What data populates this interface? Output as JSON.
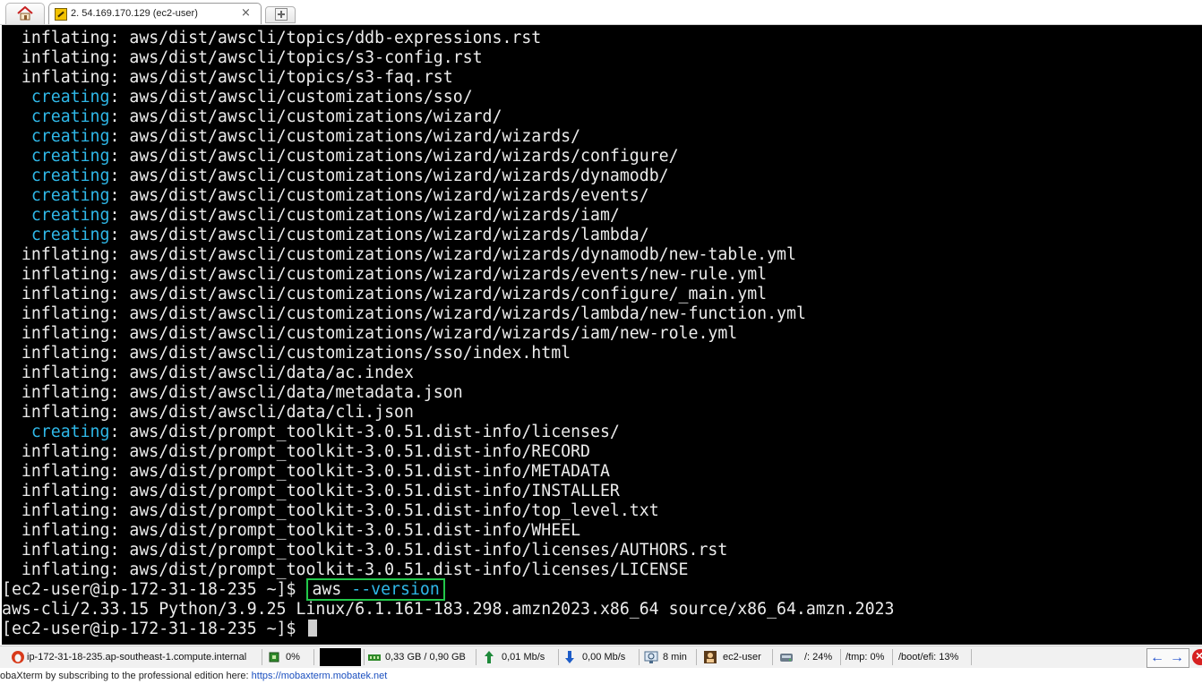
{
  "tabbar": {
    "session_tab_label": "2. 54.169.170.129 (ec2-user)",
    "close_glyph": "×"
  },
  "terminal": {
    "lines": [
      {
        "kind": "inflating",
        "prefix": "  ",
        "keyword": "inflating",
        "rest": ": aws/dist/awscli/topics/ddb-expressions.rst"
      },
      {
        "kind": "inflating",
        "prefix": "  ",
        "keyword": "inflating",
        "rest": ": aws/dist/awscli/topics/s3-config.rst"
      },
      {
        "kind": "inflating",
        "prefix": "  ",
        "keyword": "inflating",
        "rest": ": aws/dist/awscli/topics/s3-faq.rst"
      },
      {
        "kind": "creating",
        "prefix": "   ",
        "keyword": "creating",
        "rest": ": aws/dist/awscli/customizations/sso/"
      },
      {
        "kind": "creating",
        "prefix": "   ",
        "keyword": "creating",
        "rest": ": aws/dist/awscli/customizations/wizard/"
      },
      {
        "kind": "creating",
        "prefix": "   ",
        "keyword": "creating",
        "rest": ": aws/dist/awscli/customizations/wizard/wizards/"
      },
      {
        "kind": "creating",
        "prefix": "   ",
        "keyword": "creating",
        "rest": ": aws/dist/awscli/customizations/wizard/wizards/configure/"
      },
      {
        "kind": "creating",
        "prefix": "   ",
        "keyword": "creating",
        "rest": ": aws/dist/awscli/customizations/wizard/wizards/dynamodb/"
      },
      {
        "kind": "creating",
        "prefix": "   ",
        "keyword": "creating",
        "rest": ": aws/dist/awscli/customizations/wizard/wizards/events/"
      },
      {
        "kind": "creating",
        "prefix": "   ",
        "keyword": "creating",
        "rest": ": aws/dist/awscli/customizations/wizard/wizards/iam/"
      },
      {
        "kind": "creating",
        "prefix": "   ",
        "keyword": "creating",
        "rest": ": aws/dist/awscli/customizations/wizard/wizards/lambda/"
      },
      {
        "kind": "inflating",
        "prefix": "  ",
        "keyword": "inflating",
        "rest": ": aws/dist/awscli/customizations/wizard/wizards/dynamodb/new-table.yml"
      },
      {
        "kind": "inflating",
        "prefix": "  ",
        "keyword": "inflating",
        "rest": ": aws/dist/awscli/customizations/wizard/wizards/events/new-rule.yml"
      },
      {
        "kind": "inflating",
        "prefix": "  ",
        "keyword": "inflating",
        "rest": ": aws/dist/awscli/customizations/wizard/wizards/configure/_main.yml"
      },
      {
        "kind": "inflating",
        "prefix": "  ",
        "keyword": "inflating",
        "rest": ": aws/dist/awscli/customizations/wizard/wizards/lambda/new-function.yml"
      },
      {
        "kind": "inflating",
        "prefix": "  ",
        "keyword": "inflating",
        "rest": ": aws/dist/awscli/customizations/wizard/wizards/iam/new-role.yml"
      },
      {
        "kind": "inflating",
        "prefix": "  ",
        "keyword": "inflating",
        "rest": ": aws/dist/awscli/customizations/sso/index.html"
      },
      {
        "kind": "inflating",
        "prefix": "  ",
        "keyword": "inflating",
        "rest": ": aws/dist/awscli/data/ac.index"
      },
      {
        "kind": "inflating",
        "prefix": "  ",
        "keyword": "inflating",
        "rest": ": aws/dist/awscli/data/metadata.json"
      },
      {
        "kind": "inflating",
        "prefix": "  ",
        "keyword": "inflating",
        "rest": ": aws/dist/awscli/data/cli.json"
      },
      {
        "kind": "creating",
        "prefix": "   ",
        "keyword": "creating",
        "rest": ": aws/dist/prompt_toolkit-3.0.51.dist-info/licenses/"
      },
      {
        "kind": "inflating",
        "prefix": "  ",
        "keyword": "inflating",
        "rest": ": aws/dist/prompt_toolkit-3.0.51.dist-info/RECORD"
      },
      {
        "kind": "inflating",
        "prefix": "  ",
        "keyword": "inflating",
        "rest": ": aws/dist/prompt_toolkit-3.0.51.dist-info/METADATA"
      },
      {
        "kind": "inflating",
        "prefix": "  ",
        "keyword": "inflating",
        "rest": ": aws/dist/prompt_toolkit-3.0.51.dist-info/INSTALLER"
      },
      {
        "kind": "inflating",
        "prefix": "  ",
        "keyword": "inflating",
        "rest": ": aws/dist/prompt_toolkit-3.0.51.dist-info/top_level.txt"
      },
      {
        "kind": "inflating",
        "prefix": "  ",
        "keyword": "inflating",
        "rest": ": aws/dist/prompt_toolkit-3.0.51.dist-info/WHEEL"
      },
      {
        "kind": "inflating",
        "prefix": "  ",
        "keyword": "inflating",
        "rest": ": aws/dist/prompt_toolkit-3.0.51.dist-info/licenses/AUTHORS.rst"
      },
      {
        "kind": "inflating",
        "prefix": "  ",
        "keyword": "inflating",
        "rest": ": aws/dist/prompt_toolkit-3.0.51.dist-info/licenses/LICENSE"
      }
    ],
    "prompt": "[ec2-user@ip-172-31-18-235 ~]$ ",
    "command_name": "aws",
    "command_option": "--version",
    "version_output": "aws-cli/2.33.15 Python/3.9.25 Linux/6.1.161-183.298.amzn2023.x86_64 source/x86_64.amzn.2023",
    "final_prompt": "[ec2-user@ip-172-31-18-235 ~]$ "
  },
  "statusbar": {
    "host": "ip-172-31-18-235.ap-southeast-1.compute.internal",
    "cpu": "0%",
    "memory": "0,33 GB / 0,90 GB",
    "upload": "0,01 Mb/s",
    "download": "0,00 Mb/s",
    "uptime": "8 min",
    "user": "ec2-user",
    "disk_root": "/: 24%",
    "disk_tmp": "/tmp: 0%",
    "disk_boot": "/boot/efi: 13%",
    "arrow_left": "←",
    "arrow_right": "→"
  },
  "footer": {
    "text": "obaXterm by subscribing to the professional edition here:  ",
    "link": "https://mobaxterm.mobatek.net"
  },
  "colors": {
    "creating": "#2fb8e8",
    "command_box": "#22c84a",
    "terminal_bg": "#000000"
  }
}
